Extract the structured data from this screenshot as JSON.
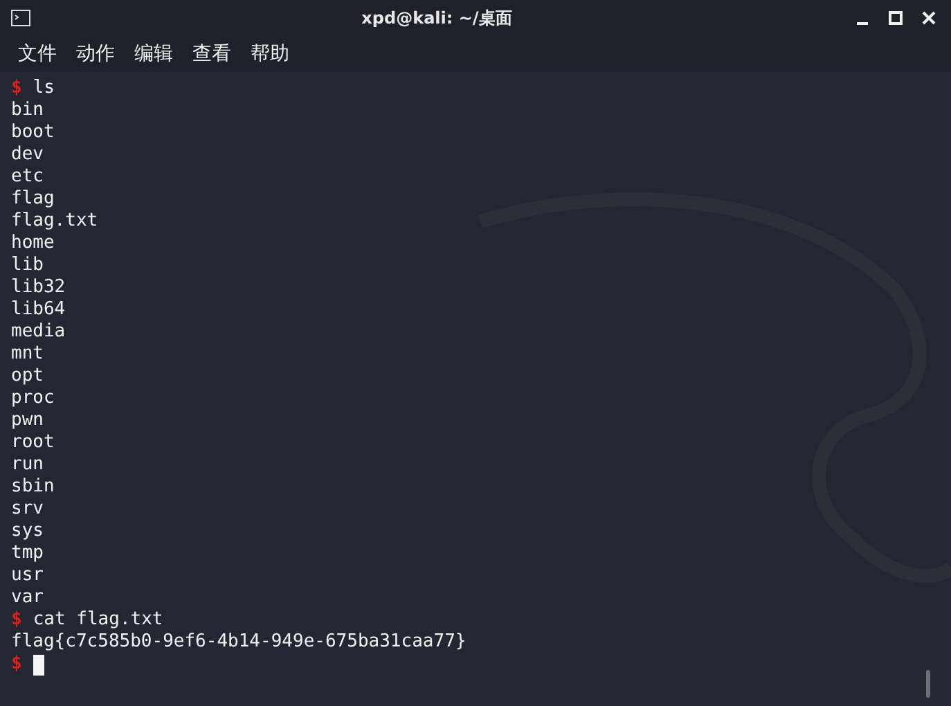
{
  "window": {
    "title": "xpd@kali: ~/桌面"
  },
  "menu": [
    "文件",
    "动作",
    "编辑",
    "查看",
    "帮助"
  ],
  "lines": [
    {
      "kind": "prompt",
      "prompt": "$",
      "text": "ls"
    },
    {
      "kind": "output",
      "text": "bin"
    },
    {
      "kind": "output",
      "text": "boot"
    },
    {
      "kind": "output",
      "text": "dev"
    },
    {
      "kind": "output",
      "text": "etc"
    },
    {
      "kind": "output",
      "text": "flag"
    },
    {
      "kind": "output",
      "text": "flag.txt"
    },
    {
      "kind": "output",
      "text": "home"
    },
    {
      "kind": "output",
      "text": "lib"
    },
    {
      "kind": "output",
      "text": "lib32"
    },
    {
      "kind": "output",
      "text": "lib64"
    },
    {
      "kind": "output",
      "text": "media"
    },
    {
      "kind": "output",
      "text": "mnt"
    },
    {
      "kind": "output",
      "text": "opt"
    },
    {
      "kind": "output",
      "text": "proc"
    },
    {
      "kind": "output",
      "text": "pwn"
    },
    {
      "kind": "output",
      "text": "root"
    },
    {
      "kind": "output",
      "text": "run"
    },
    {
      "kind": "output",
      "text": "sbin"
    },
    {
      "kind": "output",
      "text": "srv"
    },
    {
      "kind": "output",
      "text": "sys"
    },
    {
      "kind": "output",
      "text": "tmp"
    },
    {
      "kind": "output",
      "text": "usr"
    },
    {
      "kind": "output",
      "text": "var"
    },
    {
      "kind": "prompt",
      "prompt": "$",
      "text": "cat flag.txt"
    },
    {
      "kind": "output",
      "text": "flag{c7c585b0-9ef6-4b14-949e-675ba31caa77}"
    },
    {
      "kind": "cursor",
      "prompt": "$"
    }
  ]
}
